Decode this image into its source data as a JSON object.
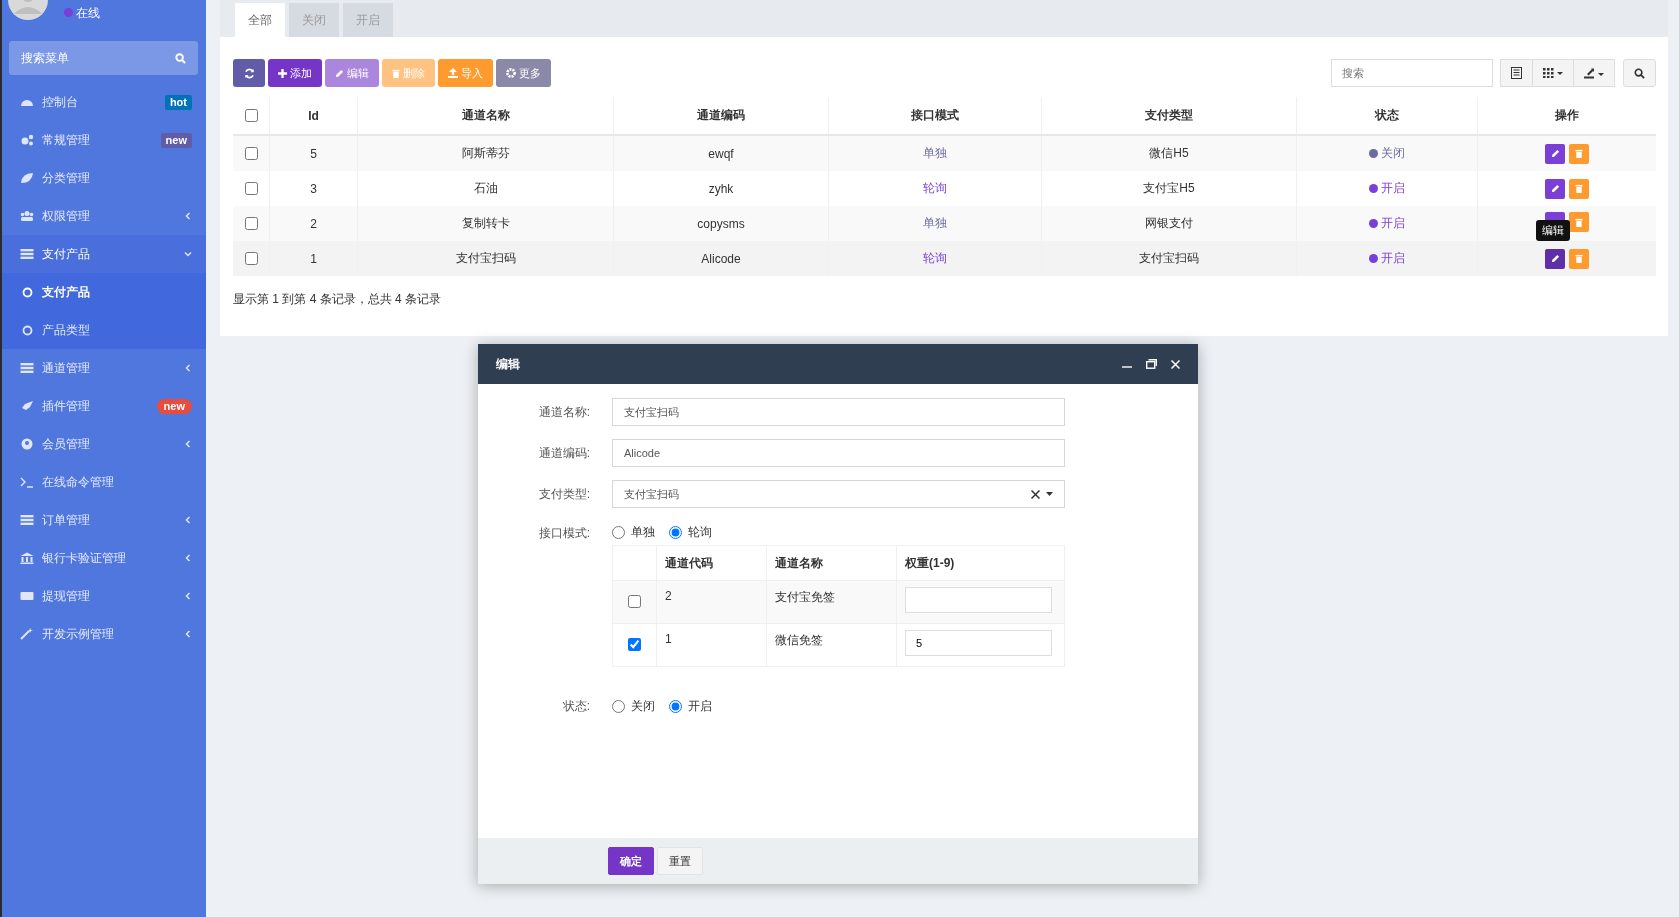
{
  "sidebar": {
    "status": "在线",
    "search_placeholder": "搜索菜单",
    "items": [
      {
        "label": "控制台",
        "badge": "hot",
        "color": "#0073b7"
      },
      {
        "label": "常规管理",
        "badge": "new",
        "color": "#605ca8"
      },
      {
        "label": "分类管理"
      },
      {
        "label": "权限管理",
        "expanded": false
      },
      {
        "label": "支付产品",
        "expanded": true,
        "children": [
          {
            "label": "支付产品",
            "selected": true
          },
          {
            "label": "产品类型",
            "selected": false
          }
        ]
      },
      {
        "label": "通道管理",
        "expanded": false
      },
      {
        "label": "插件管理",
        "badge": "new",
        "color": "#e74c3c"
      },
      {
        "label": "会员管理",
        "expanded": false
      },
      {
        "label": "在线命令管理"
      },
      {
        "label": "订单管理",
        "expanded": false
      },
      {
        "label": "银行卡验证管理",
        "expanded": false
      },
      {
        "label": "提现管理",
        "expanded": false
      },
      {
        "label": "开发示例管理",
        "expanded": false
      }
    ]
  },
  "tabs": [
    {
      "label": "全部",
      "selected": true
    },
    {
      "label": "关闭",
      "selected": false
    },
    {
      "label": "开启",
      "selected": false
    }
  ],
  "toolbar": {
    "buttons": [
      {
        "kind": "refresh",
        "disabled": false
      },
      {
        "kind": "add",
        "label": "添加",
        "disabled": false
      },
      {
        "kind": "edit",
        "label": "编辑",
        "disabled": true
      },
      {
        "kind": "delete",
        "label": "删除",
        "disabled": true
      },
      {
        "kind": "import",
        "label": "导入",
        "disabled": false
      },
      {
        "kind": "more",
        "label": "更多",
        "disabled": false
      }
    ],
    "search_placeholder": "搜索"
  },
  "table": {
    "select_all_checked": false,
    "columns": [
      "Id",
      "通道名称",
      "通道编码",
      "接口模式",
      "支付类型",
      "状态",
      "操作"
    ],
    "rows": [
      {
        "checked": false,
        "hovered": false,
        "id": "5",
        "name": "阿斯蒂芬",
        "code": "ewqf",
        "mode": "单独",
        "polling": false,
        "pay_type": "微信H5",
        "status": "关闭",
        "color": "#6b6b9f"
      },
      {
        "checked": false,
        "hovered": false,
        "id": "3",
        "name": "石油",
        "code": "zyhk",
        "mode": "轮询",
        "polling": true,
        "pay_type": "支付宝H5",
        "status": "开启",
        "color": "#7b3fd6"
      },
      {
        "checked": false,
        "hovered": false,
        "id": "2",
        "name": "复制转卡",
        "code": "copysms",
        "mode": "单独",
        "polling": false,
        "pay_type": "网银支付",
        "status": "开启",
        "color": "#7b3fd6"
      },
      {
        "checked": false,
        "hovered": true,
        "id": "1",
        "name": "支付宝扫码",
        "code": "Alicode",
        "mode": "轮询",
        "polling": true,
        "pay_type": "支付宝扫码",
        "status": "开启",
        "color": "#7b3fd6",
        "tooltip": "编辑"
      }
    ],
    "summary": "显示第 1 到第 4 条记录，总共 4 条记录"
  },
  "dialog": {
    "title": "编辑",
    "fields": [
      {
        "label": "通道名称:",
        "kind": "input",
        "value": "支付宝扫码"
      },
      {
        "label": "通道编码:",
        "kind": "input",
        "value": "Alicode"
      },
      {
        "label": "支付类型:",
        "kind": "select",
        "value": "支付宝扫码"
      }
    ],
    "mode": {
      "label": "接口模式:",
      "options": [
        {
          "label": "单独",
          "selected": false
        },
        {
          "label": "轮询",
          "selected": true
        }
      ]
    },
    "channels": {
      "columns": [
        "通道代码",
        "通道名称",
        "权重(1-9)"
      ],
      "rows": [
        {
          "checked": false,
          "code": "2",
          "name": "支付宝免签"
        },
        {
          "checked": true,
          "code": "1",
          "name": "微信免签",
          "weight": "5"
        }
      ]
    },
    "status": {
      "label": "状态:",
      "options": [
        {
          "label": "关闭",
          "selected": false
        },
        {
          "label": "开启",
          "selected": true
        }
      ]
    },
    "buttons": [
      {
        "kind": "primary",
        "label": "确定"
      },
      {
        "kind": "default",
        "label": "重置"
      }
    ]
  }
}
